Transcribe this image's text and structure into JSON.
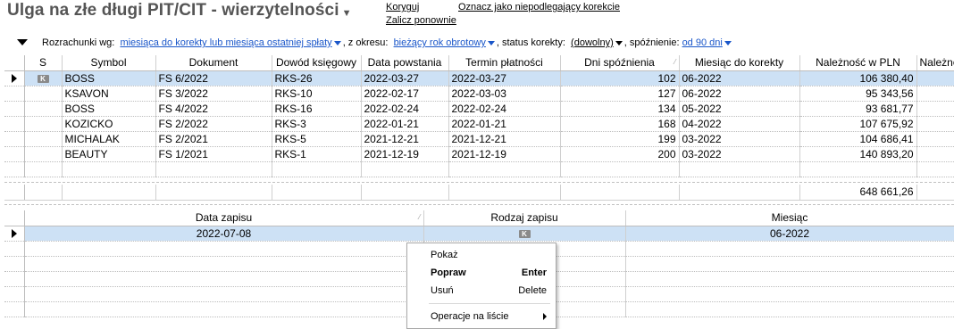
{
  "header": {
    "title": "Ulga na złe długi PIT/CIT - wierzytelności",
    "links": {
      "koryguj": "Koryguj",
      "zalicz": "Zalicz ponownie",
      "oznacz": "Oznacz jako niepodlegający korekcie"
    }
  },
  "filters": {
    "rozrachunki_label": "Rozrachunki wg:",
    "rozrachunki_value": "miesiąca do korekty lub miesiąca ostatniej spłaty",
    "okres_label": ", z okresu:",
    "okres_value": "bieżący rok obrotowy",
    "status_label": ", status korekty:",
    "status_value": "(dowolny)",
    "spoznienie_label": ", spóźnienie:",
    "spoznienie_value": "od 90 dni"
  },
  "main_grid": {
    "columns": [
      "S",
      "Symbol",
      "Dokument",
      "Dowód księgowy",
      "Data powstania",
      "Termin płatności",
      "Dni spóźnienia",
      "Miesiąc do korekty",
      "Należność w PLN",
      "Należno"
    ],
    "rows": [
      {
        "s": "K",
        "symbol": "BOSS",
        "dokument": "FS 6/2022",
        "dowod": "RKS-26",
        "data": "2022-03-27",
        "termin": "2022-03-27",
        "dni": "102",
        "miesiac": "06-2022",
        "naleznosc": "106 380,40"
      },
      {
        "s": "",
        "symbol": "KSAVON",
        "dokument": "FS 3/2022",
        "dowod": "RKS-10",
        "data": "2022-02-17",
        "termin": "2022-03-03",
        "dni": "127",
        "miesiac": "06-2022",
        "naleznosc": "95 343,56"
      },
      {
        "s": "",
        "symbol": "BOSS",
        "dokument": "FS 4/2022",
        "dowod": "RKS-16",
        "data": "2022-02-24",
        "termin": "2022-02-24",
        "dni": "134",
        "miesiac": "05-2022",
        "naleznosc": "93 681,77"
      },
      {
        "s": "",
        "symbol": "KOZICKO",
        "dokument": "FS 2/2022",
        "dowod": "RKS-3",
        "data": "2022-01-21",
        "termin": "2022-01-21",
        "dni": "168",
        "miesiac": "04-2022",
        "naleznosc": "107 675,92"
      },
      {
        "s": "",
        "symbol": "MICHALAK",
        "dokument": "FS 2/2021",
        "dowod": "RKS-5",
        "data": "2021-12-21",
        "termin": "2021-12-21",
        "dni": "199",
        "miesiac": "03-2022",
        "naleznosc": "104 686,41"
      },
      {
        "s": "",
        "symbol": "BEAUTY",
        "dokument": "FS 1/2021",
        "dowod": "RKS-1",
        "data": "2021-12-19",
        "termin": "2021-12-19",
        "dni": "200",
        "miesiac": "03-2022",
        "naleznosc": "140 893,20"
      }
    ],
    "total": "648 661,26"
  },
  "detail_grid": {
    "columns": [
      "Data zapisu",
      "Rodzaj zapisu",
      "Miesiąc"
    ],
    "rows": [
      {
        "data": "2022-07-08",
        "rodzaj": "K",
        "miesiac": "06-2022"
      }
    ]
  },
  "context_menu": {
    "items": [
      {
        "label": "Pokaż",
        "key": ""
      },
      {
        "label": "Popraw",
        "key": "Enter"
      },
      {
        "label": "Usuń",
        "key": "Delete"
      },
      {
        "label": "Operacje na liście",
        "key": ""
      }
    ]
  }
}
